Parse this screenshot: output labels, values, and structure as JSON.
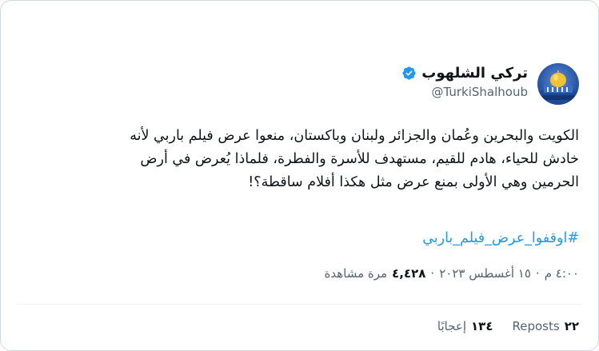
{
  "tweet": {
    "author": {
      "display_name": "تركي الشلهوب",
      "handle": "@TurkiShalhoub",
      "verified": true,
      "avatar_icon": "al-aqsa-dome-avatar"
    },
    "text_lines": [
      "الكويت والبحرين وعُمان والجزائر ولبنان وباكستان، منعوا عرض فيلم باربي لأنه",
      "خادش للحياء، هادم للقيم، مستهدف للأسرة والفطرة، فلماذا يُعرض في أرض",
      "الحرمين وهي الأولى بمنع عرض مثل هكذا أفلام ساقطة؟!"
    ],
    "hashtag": "#اوقفوا_عرض_فيلم_باربي",
    "time": "٤:٠٠ م",
    "date": "١٥ أغسطس ٢٠٢٣",
    "views": "٤,٤٢٨",
    "views_label": "مرة مشاهدة",
    "separator": "·",
    "stats": {
      "reposts_count": "٢٢",
      "reposts_label": "Reposts",
      "likes_count": "١٣٤",
      "likes_label": "إعجابًا"
    },
    "colors": {
      "link": "#1d9bf0",
      "text": "#0f1419",
      "muted": "#536471",
      "border": "#cfd9de"
    }
  }
}
